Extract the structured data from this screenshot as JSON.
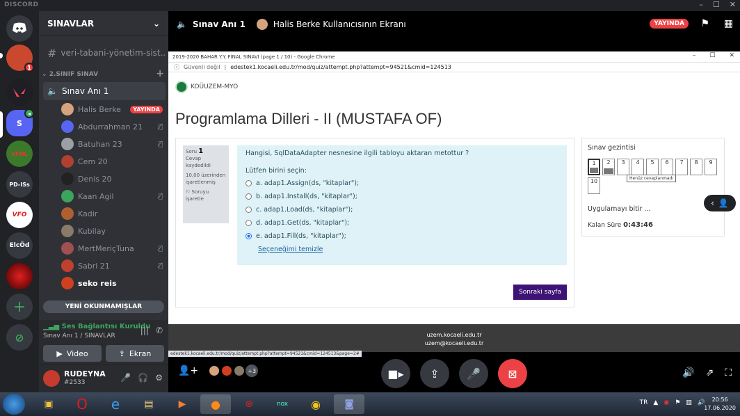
{
  "app": {
    "brand": "DISCORD"
  },
  "servers": [
    {
      "name": "home",
      "label": ""
    },
    {
      "name": "server-avatar-1",
      "badge": "1"
    },
    {
      "name": "valorant",
      "label": ""
    },
    {
      "name": "s-server",
      "label": "S"
    },
    {
      "name": "vfol",
      "label": "VFOL"
    },
    {
      "name": "pd-iss",
      "label": "PD-ISs"
    },
    {
      "name": "vfo",
      "label": "VFO"
    },
    {
      "name": "elcod",
      "label": "ElcÖd"
    },
    {
      "name": "red-server",
      "label": ""
    }
  ],
  "sidebar": {
    "server_name": "SINAVLAR",
    "text_channel": "veri-tabani-yönetim-sist...",
    "category": "2.SINIF SINAV",
    "voice_channel": "Sınav Anı 1",
    "users": [
      {
        "name": "Halis Berke",
        "live": "YAYINDA",
        "color": "#d5a37d"
      },
      {
        "name": "Abdurrahman 21",
        "mute": "mic-off",
        "color": "#5865f2"
      },
      {
        "name": "Batuhan 23",
        "mute": "mic-off",
        "color": "#9aa0a6"
      },
      {
        "name": "Cem 20",
        "mute": "",
        "color": "#b04030"
      },
      {
        "name": "Denis 20",
        "mute": "",
        "color": "#222222"
      },
      {
        "name": "Kaan Agil",
        "mute": "mic-off",
        "color": "#3ba55d"
      },
      {
        "name": "Kadir",
        "mute": "",
        "color": "#b06030"
      },
      {
        "name": "Kubilay",
        "mute": "",
        "color": "#8a7a6a"
      },
      {
        "name": "MertMeriçTuna",
        "mute": "mic-off",
        "color": "#a05050"
      },
      {
        "name": "Sabri 21",
        "mute": "mic-off",
        "color": "#c04030"
      },
      {
        "name": "seko reis",
        "mute": "",
        "color": "#d04020",
        "bold": true
      }
    ],
    "new_unreads": "YENİ OKUNMAMIŞLAR",
    "voice_status": "Ses Bağlantısı Kuruldu",
    "voice_location": "Sınav Anı 1 / SINAVLAR",
    "video_label": "Video",
    "screen_label": "Ekran",
    "username": "RUDEYNA",
    "usertag": "#2533"
  },
  "stream": {
    "channel": "Sınav Anı 1",
    "title": "Halis Berke Kullanıcısının Ekranı",
    "live": "YAYINDA"
  },
  "browser": {
    "window_title": "2019-2020 BAHAR Y.Y. FİNAL SINAVI (page 1 / 10) - Google Chrome",
    "security": "Güvenli değil",
    "url": "edestek1.kocaeli.edu.tr/mod/quiz/attempt.php?attempt=94521&cmid=124513",
    "site_name": "KOÜUZEM-MYO",
    "page_title": "Programlama Dilleri - II (MUSTAFA OF)",
    "question_label": "Soru",
    "question_no": "1",
    "status_answered": "Cevap kaydedildi",
    "score": "10,00 üzerinden işaretlenmiş",
    "flag": "Soruyu işaretle",
    "question_text": "Hangisi, SqlDataAdapter nesnesine ilgili tabloyu aktaran metottur ?",
    "prompt": "Lütfen birini seçin:",
    "options": [
      "a. adap1.Assign(ds, \"kitaplar\");",
      "b. adap1.Install(ds, \"kitaplar\");",
      "c. adap1.Load(ds, \"kitaplar\");",
      "d. adap1.Get(ds, \"kitaplar\");",
      "e. adap1.Fill(ds, \"kitaplar\");"
    ],
    "selected_option": 4,
    "clear_choice": "Seçeneğimi temizle",
    "next_button": "Sonraki sayfa",
    "nav_title": "Sınav gezintisi",
    "nav_pages": [
      "1",
      "2",
      "3",
      "4",
      "5",
      "6",
      "7",
      "8",
      "9",
      "10"
    ],
    "tooltip": "Henüz cevaplanmadı",
    "finish_label": "Uygulamayı bitir ...",
    "time_label": "Kalan Süre",
    "time_value": "0:43:46",
    "footer_line1": "uzem.kocaeli.edu.tr",
    "footer_line2": "uzem@kocaeli.edu.tr",
    "status_url": "edestek1.kocaeli.edu.tr/mod/quiz/attempt.php?attempt=94521&cmid=124513&page=2#"
  },
  "controls": {
    "extra_viewers": "+3"
  },
  "taskbar": {
    "lang": "TR",
    "time": "20:56",
    "date": "17.06.2020"
  }
}
